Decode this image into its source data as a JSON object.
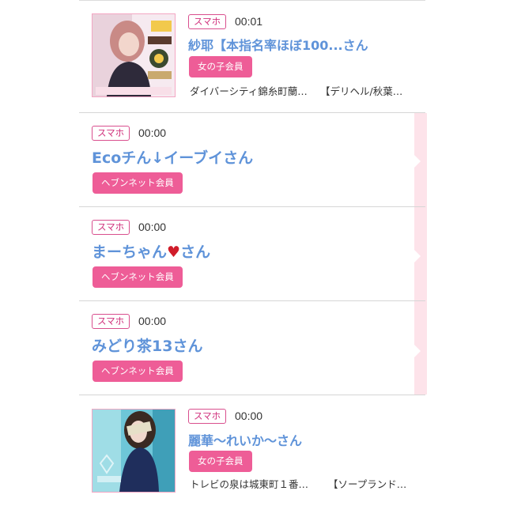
{
  "items": [
    {
      "tag": "スマホ",
      "time": "00:01",
      "name": "紗耶【本指名率ほぼ100...さん",
      "badge": "女の子会員",
      "location": "ダイバーシティ錦糸町蘭…",
      "category": "【デリヘル/秋葉…"
    },
    {
      "tag": "スマホ",
      "time": "00:00",
      "name": "Ecoチん↓イーブイさん",
      "badge": "ヘブンネット会員"
    },
    {
      "tag": "スマホ",
      "time": "00:00",
      "name_before": "まーちゃん",
      "name_after": "さん",
      "badge": "ヘブンネット会員"
    },
    {
      "tag": "スマホ",
      "time": "00:00",
      "name": "みどり茶13さん",
      "badge": "ヘブンネット会員"
    },
    {
      "tag": "スマホ",
      "time": "00:00",
      "name": "麗華～れいか～さん",
      "badge": "女の子会員",
      "location": "トレビの泉は城東町１番…",
      "category": "【ソープランド…"
    }
  ],
  "colors": {
    "accent_pink": "#ee5d97",
    "name_blue": "#5f93d9",
    "highlight_bg": "#fde3ea"
  }
}
